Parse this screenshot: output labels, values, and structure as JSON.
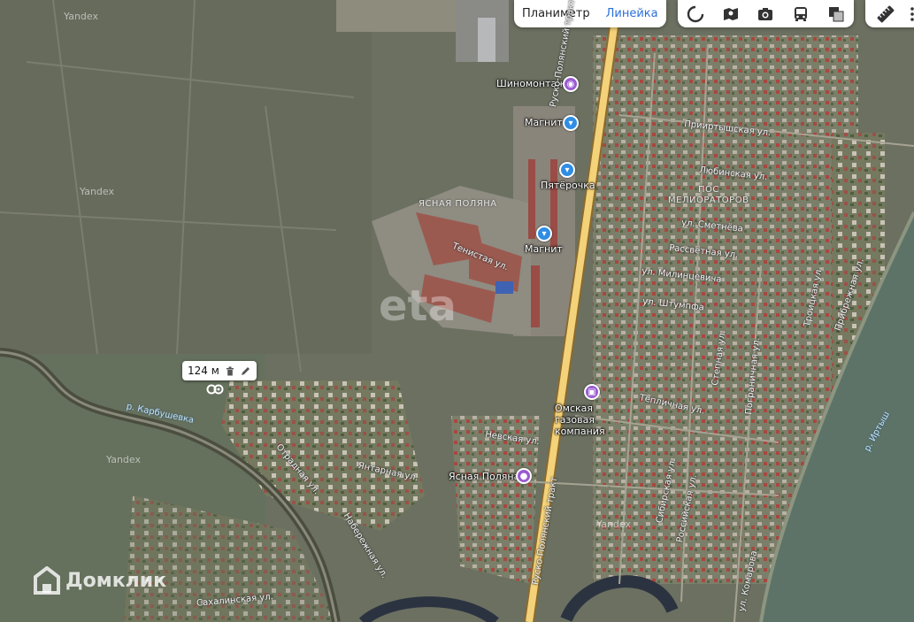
{
  "toolbar": {
    "tabs": [
      "Планиметр",
      "Линейка"
    ],
    "active_tab": "Линейка",
    "layer_buttons": [
      "traffic-icon",
      "panorama-icon",
      "photo-icon",
      "transport-icon",
      "layers-icon"
    ],
    "ruler_button": "ruler-icon"
  },
  "measurement": {
    "distance": "124 м"
  },
  "pois": {
    "tire_service": "Шиномонтаж",
    "magnit_1": "Магнит",
    "pyaterochka": "Пятёрочка",
    "magnit_2": "Магнит",
    "gas_company": "Омская газовая компания",
    "yasnaya_polyana_stop": "Ясная Поляна"
  },
  "districts": {
    "yasnaya_polyana": "ЯСНАЯ ПОЛЯНА",
    "pos": "ПОС",
    "melioratorov": "МЕЛИОРАТОРОВ"
  },
  "streets": {
    "rusko_polyansky_trakt_top": "Руско-Полянский тракт",
    "rusko_polyansky_trakt_bottom": "Руско-Полянский тракт",
    "priirtyshskaya": "Прииртышская ул.",
    "lyubinskaya": "Любинская ул.",
    "smetneva": "ул. Сметнёва",
    "rassvetnaya": "Рассветная ул.",
    "milintsevicha": "ул. Милинцевича",
    "shtumpfa": "ул. Штумпфа",
    "tenistaya": "Тенистая ул.",
    "nevskaya": "Невская ул.",
    "teplichnaya": "Тепличная ул.",
    "otradnaya": "Отрадная ул.",
    "yantarnaya": "Янтарная ул.",
    "naberezhnaya": "Набережная ул.",
    "sakhalinskaya": "Сахалинская ул.",
    "sibirskaya": "Сибирская ул.",
    "rossiyskaya": "Российская ул.",
    "stepnaya": "Степная ул.",
    "pogranichnaya": "Пограничная ул.",
    "troitskaya": "Троицкая ул.",
    "pribrezhnaya": "Прибрежная ул.",
    "komarova": "ул. Комарова"
  },
  "water": {
    "karbushevka": "р. Карбушевка",
    "irtysh": "р. Иртыш"
  },
  "yandex_marks": [
    "Yandex",
    "Yandex",
    "Yandex",
    "Yandex"
  ],
  "watermarks": {
    "center": "eta",
    "brand": "Домклик"
  }
}
